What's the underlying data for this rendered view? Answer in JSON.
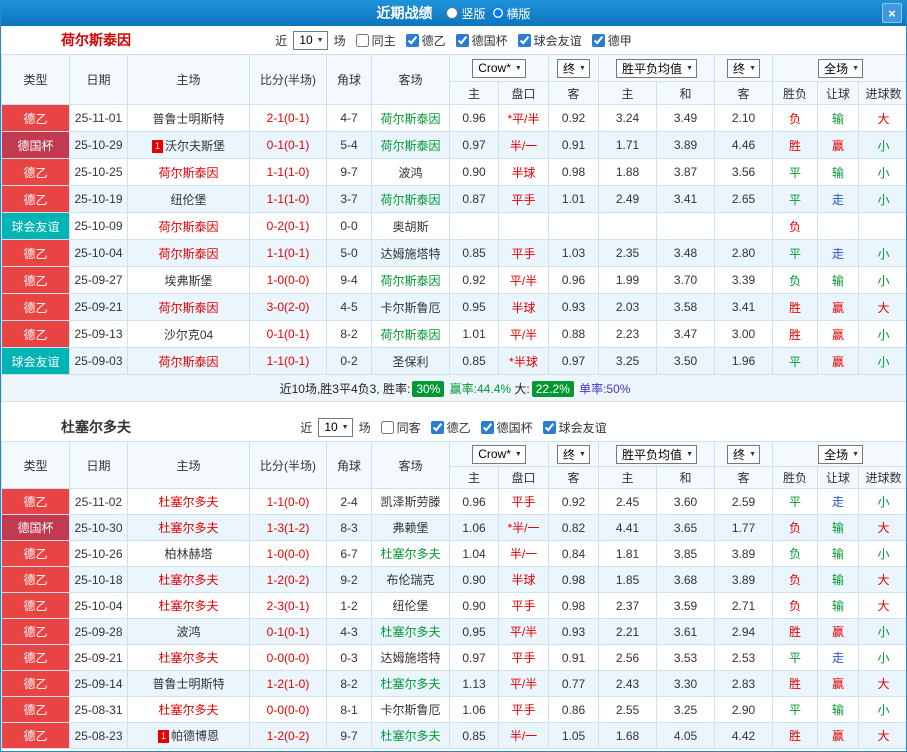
{
  "titlebar": {
    "title": "近期战绩",
    "radio_vertical": "竖版",
    "radio_horizontal": "横版",
    "horizontal_selected": true,
    "close": "×"
  },
  "table_headers": {
    "type": "类型",
    "date": "日期",
    "home": "主场",
    "score": "比分(半场)",
    "corner": "角球",
    "away": "客场",
    "odds_home": "主",
    "odds_handicap": "盘口",
    "odds_away": "客",
    "avg_home": "主",
    "avg_draw": "和",
    "avg_away": "客",
    "result": "胜负",
    "handicap_result": "让球",
    "goals": "进球数",
    "dd_company": "Crow*",
    "dd_final": "终",
    "dd_avg": "胜平负均值",
    "dd_final2": "终",
    "dd_full": "全场"
  },
  "colors": {
    "result_red": "#e60000",
    "result_green": "#009933",
    "result_blue": "#2b51c8",
    "types": {
      "德乙": "#e94444",
      "德国杯": "#c23a52",
      "球会友谊": "#00b4b4",
      "德甲": "#e94444"
    }
  },
  "sections": [
    {
      "team": "荷尔斯泰因",
      "team_color": "#d40000",
      "near_label": "近",
      "near_value": "10",
      "games_label": "场",
      "checkboxes": [
        {
          "label": "同主",
          "checked": false
        },
        {
          "label": "德乙",
          "checked": true
        },
        {
          "label": "德国杯",
          "checked": true
        },
        {
          "label": "球会友谊",
          "checked": true
        },
        {
          "label": "德甲",
          "checked": true
        }
      ],
      "rows": [
        {
          "type": "德乙",
          "date": "25-11-01",
          "home": "普鲁士明斯特",
          "badge": "",
          "score": "2-1(0-1)",
          "corner": "4-7",
          "away": "荷尔斯泰因",
          "away_hl": true,
          "o1": "0.96",
          "hc": "*平/半",
          "o2": "0.92",
          "m1": "3.24",
          "m2": "3.49",
          "m3": "2.10",
          "res": "负",
          "resc": "red",
          "hres": "输",
          "hresc": "green",
          "gres": "大",
          "gresc": "red"
        },
        {
          "type": "德国杯",
          "date": "25-10-29",
          "home": "沃尔夫斯堡",
          "badge": "1",
          "score": "0-1(0-1)",
          "corner": "5-4",
          "away": "荷尔斯泰因",
          "away_hl": true,
          "o1": "0.97",
          "hc": "半/一",
          "o2": "0.91",
          "m1": "1.71",
          "m2": "3.89",
          "m3": "4.46",
          "res": "胜",
          "resc": "red",
          "hres": "赢",
          "hresc": "red",
          "gres": "小",
          "gresc": "green"
        },
        {
          "type": "德乙",
          "date": "25-10-25",
          "home": "荷尔斯泰因",
          "home_hl": true,
          "badge": "",
          "score": "1-1(1-0)",
          "corner": "9-7",
          "away": "波鸿",
          "o1": "0.90",
          "hc": "半球",
          "o2": "0.98",
          "m1": "1.88",
          "m2": "3.87",
          "m3": "3.56",
          "res": "平",
          "resc": "green",
          "hres": "输",
          "hresc": "green",
          "gres": "小",
          "gresc": "green"
        },
        {
          "type": "德乙",
          "date": "25-10-19",
          "home": "纽伦堡",
          "badge": "",
          "score": "1-1(1-0)",
          "corner": "3-7",
          "away": "荷尔斯泰因",
          "away_hl": true,
          "o1": "0.87",
          "hc": "平手",
          "o2": "1.01",
          "m1": "2.49",
          "m2": "3.41",
          "m3": "2.65",
          "res": "平",
          "resc": "green",
          "hres": "走",
          "hresc": "blue",
          "gres": "小",
          "gresc": "green"
        },
        {
          "type": "球会友谊",
          "date": "25-10-09",
          "home": "荷尔斯泰因",
          "home_hl": true,
          "badge": "",
          "score": "0-2(0-1)",
          "corner": "0-0",
          "away": "奥胡斯",
          "o1": "",
          "hc": "",
          "o2": "",
          "m1": "",
          "m2": "",
          "m3": "",
          "res": "负",
          "resc": "red",
          "hres": "",
          "hresc": "",
          "gres": "",
          "gresc": ""
        },
        {
          "type": "德乙",
          "date": "25-10-04",
          "home": "荷尔斯泰因",
          "home_hl": true,
          "badge": "",
          "score": "1-1(0-1)",
          "corner": "5-0",
          "away": "达姆施塔特",
          "o1": "0.85",
          "hc": "平手",
          "o2": "1.03",
          "m1": "2.35",
          "m2": "3.48",
          "m3": "2.80",
          "res": "平",
          "resc": "green",
          "hres": "走",
          "hresc": "blue",
          "gres": "小",
          "gresc": "green"
        },
        {
          "type": "德乙",
          "date": "25-09-27",
          "home": "埃弗斯堡",
          "badge": "",
          "score": "1-0(0-0)",
          "corner": "9-4",
          "away": "荷尔斯泰因",
          "away_hl": true,
          "o1": "0.92",
          "hc": "平/半",
          "o2": "0.96",
          "m1": "1.99",
          "m2": "3.70",
          "m3": "3.39",
          "res": "负",
          "resc": "green",
          "hres": "输",
          "hresc": "green",
          "gres": "小",
          "gresc": "green"
        },
        {
          "type": "德乙",
          "date": "25-09-21",
          "home": "荷尔斯泰因",
          "home_hl": true,
          "badge": "",
          "score": "3-0(2-0)",
          "corner": "4-5",
          "away": "卡尔斯鲁厄",
          "o1": "0.95",
          "hc": "半球",
          "o2": "0.93",
          "m1": "2.03",
          "m2": "3.58",
          "m3": "3.41",
          "res": "胜",
          "resc": "red",
          "hres": "赢",
          "hresc": "red",
          "gres": "大",
          "gresc": "red"
        },
        {
          "type": "德乙",
          "date": "25-09-13",
          "home": "沙尔克04",
          "badge": "",
          "score": "0-1(0-1)",
          "corner": "8-2",
          "away": "荷尔斯泰因",
          "away_hl": true,
          "o1": "1.01",
          "hc": "平/半",
          "o2": "0.88",
          "m1": "2.23",
          "m2": "3.47",
          "m3": "3.00",
          "res": "胜",
          "resc": "red",
          "hres": "赢",
          "hresc": "red",
          "gres": "小",
          "gresc": "green"
        },
        {
          "type": "球会友谊",
          "date": "25-09-03",
          "home": "荷尔斯泰因",
          "home_hl": true,
          "badge": "",
          "score": "1-1(0-1)",
          "corner": "0-2",
          "away": "圣保利",
          "o1": "0.85",
          "hc": "*半球",
          "o2": "0.97",
          "m1": "3.25",
          "m2": "3.50",
          "m3": "1.96",
          "res": "平",
          "resc": "green",
          "hres": "赢",
          "hresc": "red",
          "gres": "小",
          "gresc": "green"
        }
      ],
      "summary": {
        "parts": [
          {
            "text": "近10场,胜3平4负3, 胜率:",
            "style": "plain"
          },
          {
            "text": "30%",
            "style": "badge"
          },
          {
            "text": " 赢率:44.4%",
            "style": "green"
          },
          {
            "text": " 大:",
            "style": "plain"
          },
          {
            "text": "22.2%",
            "style": "badge"
          },
          {
            "text": " 单率:50%",
            "style": "purple"
          }
        ]
      }
    },
    {
      "team": "杜塞尔多夫",
      "team_color": "#333333",
      "near_label": "近",
      "near_value": "10",
      "games_label": "场",
      "checkboxes": [
        {
          "label": "同客",
          "checked": false
        },
        {
          "label": "德乙",
          "checked": true
        },
        {
          "label": "德国杯",
          "checked": true
        },
        {
          "label": "球会友谊",
          "checked": true
        }
      ],
      "rows": [
        {
          "type": "德乙",
          "date": "25-11-02",
          "home": "杜塞尔多夫",
          "home_hl": true,
          "badge": "",
          "score": "1-1(0-0)",
          "corner": "2-4",
          "away": "凯泽斯劳滕",
          "o1": "0.96",
          "hc": "平手",
          "o2": "0.92",
          "m1": "2.45",
          "m2": "3.60",
          "m3": "2.59",
          "res": "平",
          "resc": "green",
          "hres": "走",
          "hresc": "blue",
          "gres": "小",
          "gresc": "green"
        },
        {
          "type": "德国杯",
          "date": "25-10-30",
          "home": "杜塞尔多夫",
          "home_hl": true,
          "badge": "",
          "score": "1-3(1-2)",
          "corner": "8-3",
          "away": "弗赖堡",
          "o1": "1.06",
          "hc": "*半/一",
          "o2": "0.82",
          "m1": "4.41",
          "m2": "3.65",
          "m3": "1.77",
          "res": "负",
          "resc": "red",
          "hres": "输",
          "hresc": "green",
          "gres": "大",
          "gresc": "red"
        },
        {
          "type": "德乙",
          "date": "25-10-26",
          "home": "柏林赫塔",
          "badge": "",
          "score": "1-0(0-0)",
          "corner": "6-7",
          "away": "杜塞尔多夫",
          "away_hl": true,
          "o1": "1.04",
          "hc": "半/一",
          "o2": "0.84",
          "m1": "1.81",
          "m2": "3.85",
          "m3": "3.89",
          "res": "负",
          "resc": "green",
          "hres": "输",
          "hresc": "green",
          "gres": "小",
          "gresc": "green"
        },
        {
          "type": "德乙",
          "date": "25-10-18",
          "home": "杜塞尔多夫",
          "home_hl": true,
          "badge": "",
          "score": "1-2(0-2)",
          "corner": "9-2",
          "away": "布伦瑞克",
          "o1": "0.90",
          "hc": "半球",
          "o2": "0.98",
          "m1": "1.85",
          "m2": "3.68",
          "m3": "3.89",
          "res": "负",
          "resc": "red",
          "hres": "输",
          "hresc": "green",
          "gres": "大",
          "gresc": "red"
        },
        {
          "type": "德乙",
          "date": "25-10-04",
          "home": "杜塞尔多夫",
          "home_hl": true,
          "badge": "",
          "score": "2-3(0-1)",
          "corner": "1-2",
          "away": "纽伦堡",
          "o1": "0.90",
          "hc": "平手",
          "o2": "0.98",
          "m1": "2.37",
          "m2": "3.59",
          "m3": "2.71",
          "res": "负",
          "resc": "red",
          "hres": "输",
          "hresc": "green",
          "gres": "大",
          "gresc": "red"
        },
        {
          "type": "德乙",
          "date": "25-09-28",
          "home": "波鸿",
          "badge": "",
          "score": "0-1(0-1)",
          "corner": "4-3",
          "away": "杜塞尔多夫",
          "away_hl": true,
          "o1": "0.95",
          "hc": "平/半",
          "o2": "0.93",
          "m1": "2.21",
          "m2": "3.61",
          "m3": "2.94",
          "res": "胜",
          "resc": "red",
          "hres": "赢",
          "hresc": "red",
          "gres": "小",
          "gresc": "green"
        },
        {
          "type": "德乙",
          "date": "25-09-21",
          "home": "杜塞尔多夫",
          "home_hl": true,
          "badge": "",
          "score": "0-0(0-0)",
          "corner": "0-3",
          "away": "达姆施塔特",
          "o1": "0.97",
          "hc": "平手",
          "o2": "0.91",
          "m1": "2.56",
          "m2": "3.53",
          "m3": "2.53",
          "res": "平",
          "resc": "green",
          "hres": "走",
          "hresc": "blue",
          "gres": "小",
          "gresc": "green"
        },
        {
          "type": "德乙",
          "date": "25-09-14",
          "home": "普鲁士明斯特",
          "badge": "",
          "score": "1-2(1-0)",
          "corner": "8-2",
          "away": "杜塞尔多夫",
          "away_hl": true,
          "o1": "1.13",
          "hc": "平/半",
          "o2": "0.77",
          "m1": "2.43",
          "m2": "3.30",
          "m3": "2.83",
          "res": "胜",
          "resc": "red",
          "hres": "赢",
          "hresc": "red",
          "gres": "大",
          "gresc": "red"
        },
        {
          "type": "德乙",
          "date": "25-08-31",
          "home": "杜塞尔多夫",
          "home_hl": true,
          "badge": "",
          "score": "0-0(0-0)",
          "corner": "8-1",
          "away": "卡尔斯鲁厄",
          "o1": "1.06",
          "hc": "平手",
          "o2": "0.86",
          "m1": "2.55",
          "m2": "3.25",
          "m3": "2.90",
          "res": "平",
          "resc": "green",
          "hres": "输",
          "hresc": "green",
          "gres": "小",
          "gresc": "green"
        },
        {
          "type": "德乙",
          "date": "25-08-23",
          "home": "帕德博恩",
          "badge": "1",
          "score": "1-2(0-2)",
          "corner": "9-7",
          "away": "杜塞尔多夫",
          "away_hl": true,
          "o1": "0.85",
          "hc": "半/一",
          "o2": "1.05",
          "m1": "1.68",
          "m2": "4.05",
          "m3": "4.42",
          "res": "胜",
          "resc": "red",
          "hres": "赢",
          "hresc": "red",
          "gres": "大",
          "gresc": "red"
        }
      ],
      "summary": null
    }
  ]
}
